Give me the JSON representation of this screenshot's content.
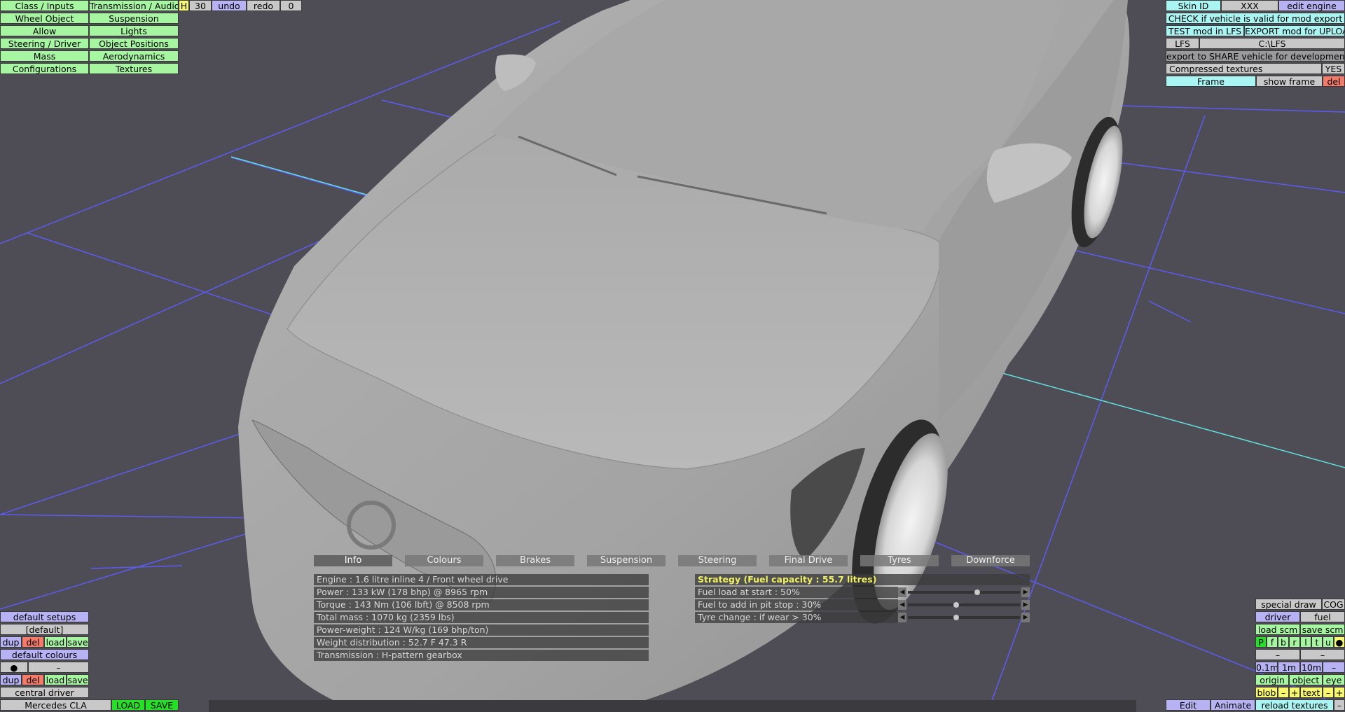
{
  "left_menu": {
    "col1": [
      "Class / Inputs",
      "Wheel Object",
      "Allow",
      "Steering / Driver",
      "Mass",
      "Configurations"
    ],
    "col2": [
      "Transmission / Audio",
      "Suspension",
      "Lights",
      "Object Positions",
      "Aerodynamics",
      "Textures"
    ]
  },
  "top_toolbar": {
    "h_label": "H",
    "num_label": "30",
    "undo_label": "undo",
    "redo_label": "redo",
    "count_label": "0"
  },
  "top_right": {
    "skin_id_label": "Skin ID",
    "skin_id_value": "XXX",
    "edit_engine_label": "edit engine",
    "check_label": "CHECK if vehicle is valid for mod export",
    "test_label": "TEST mod in LFS",
    "export_label": "EXPORT mod for UPLOAD",
    "lfs_label": "LFS",
    "lfs_path": "C:\\LFS",
    "share_label": "export to SHARE vehicle for development",
    "compressed_label": "Compressed textures",
    "compressed_value": "YES",
    "frame_label": "Frame",
    "show_frame_label": "show frame",
    "del_label": "del"
  },
  "tabs": [
    "Info",
    "Colours",
    "Brakes",
    "Suspension",
    "Steering",
    "Final Drive",
    "Tyres",
    "Downforce"
  ],
  "info_lines": [
    "Engine : 1.6 litre inline 4 / Front wheel drive",
    "Power : 133 kW (178 bhp) @ 8965 rpm",
    "Torque : 143 Nm (106 lbft) @ 8508 rpm",
    "Total mass : 1070 kg (2359 lbs)",
    "Power-weight : 124 W/kg (169 bhp/ton)",
    "Weight distribution : 52.7 F  47.3 R",
    "Transmission : H-pattern gearbox"
  ],
  "strategy": {
    "title": "Strategy (Fuel capacity : 55.7 litres)",
    "rows": [
      {
        "label": "Fuel load at start : 50%",
        "value": 0.62
      },
      {
        "label": "Fuel to add in pit stop : 30%",
        "value": 0.43
      },
      {
        "label": "Tyre change : if wear > 30%",
        "value": 0.43
      }
    ]
  },
  "bottom_left": {
    "default_setups": "default setups",
    "default_value": "[default]",
    "dup": "dup",
    "del": "del",
    "load": "load",
    "save": "save",
    "default_colours": "default colours",
    "dot": "●",
    "dash": "–",
    "central_driver": "central driver",
    "car_name": "Mercedes CLA",
    "load_btn": "LOAD",
    "save_btn": "SAVE"
  },
  "bottom_right": {
    "special_draw": "special draw",
    "cog": "COG",
    "driver": "driver",
    "fuel": "fuel",
    "load_scm": "load scm",
    "save_scm": "save scm",
    "letters": [
      "P",
      "f",
      "b",
      "r",
      "l",
      "t",
      "u"
    ],
    "dot": "●",
    "dash": "–",
    "dist": [
      "0.1m",
      "1m",
      "10m",
      "–"
    ],
    "origin": "origin",
    "object": "object",
    "eye": "eye",
    "blob": "blob",
    "minus": "–",
    "plus": "+",
    "text": "text",
    "edit": "Edit",
    "animate": "Animate",
    "reload": "reload textures"
  },
  "colors": {
    "green": "#a6f5a1",
    "blue": "#b7b2f4",
    "cyan": "#a9f5f3",
    "background": "#4e4c55",
    "strategy_title": "#f0f060"
  }
}
